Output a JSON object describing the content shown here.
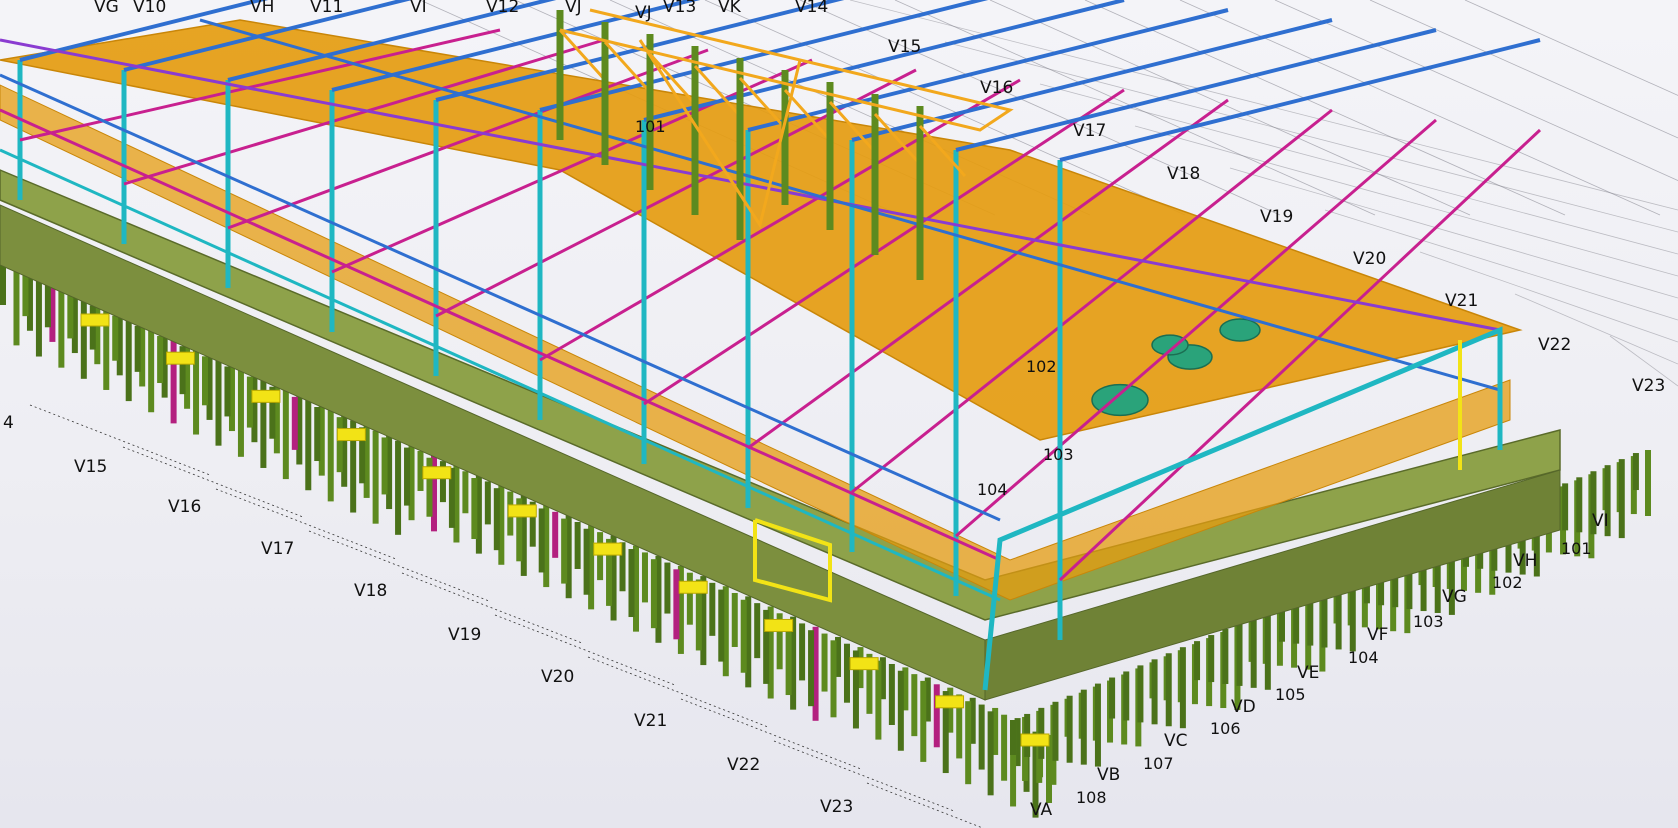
{
  "viewport": {
    "colors": {
      "slab": "#e59c10",
      "slab_dark": "#c98608",
      "floor": "#8ea24a",
      "pile": "#5d8a1f",
      "pile_dark": "#4b721a",
      "pile_magenta": "#b3207f",
      "column_cyan": "#1fb7c2",
      "beam_blue": "#2f6fd0",
      "beam_magenta": "#c8208f",
      "beam_purple": "#8a3bd1",
      "truss_orange": "#f2a81d",
      "pad_yellow": "#f2e316",
      "gridline": "#7c7c86"
    },
    "grid_labels": [
      {
        "text": "VG",
        "name": "grid-label-vg-top"
      },
      {
        "text": "V10",
        "name": "grid-label-v10"
      },
      {
        "text": "VH",
        "name": "grid-label-vh-top"
      },
      {
        "text": "V11",
        "name": "grid-label-v11"
      },
      {
        "text": "VI",
        "name": "grid-label-vi-top"
      },
      {
        "text": "V12",
        "name": "grid-label-v12"
      },
      {
        "text": "VJ",
        "name": "grid-label-vj-a"
      },
      {
        "text": "VJ",
        "name": "grid-label-vj-b"
      },
      {
        "text": "V13",
        "name": "grid-label-v13"
      },
      {
        "text": "VK",
        "name": "grid-label-vk"
      },
      {
        "text": "V14",
        "name": "grid-label-v14-top"
      },
      {
        "text": "V15",
        "name": "grid-label-v15-top"
      },
      {
        "text": "V16",
        "name": "grid-label-v16-top"
      },
      {
        "text": "V17",
        "name": "grid-label-v17-top"
      },
      {
        "text": "V18",
        "name": "grid-label-v18-top"
      },
      {
        "text": "V19",
        "name": "grid-label-v19-top"
      },
      {
        "text": "V20",
        "name": "grid-label-v20-top"
      },
      {
        "text": "V21",
        "name": "grid-label-v21-top"
      },
      {
        "text": "V22",
        "name": "grid-label-v22-top"
      },
      {
        "text": "V23",
        "name": "grid-label-v23-top"
      },
      {
        "text": "4",
        "name": "grid-label-v14-left"
      },
      {
        "text": "V15",
        "name": "grid-label-v15-bottom"
      },
      {
        "text": "V16",
        "name": "grid-label-v16-bottom"
      },
      {
        "text": "V17",
        "name": "grid-label-v17-bottom"
      },
      {
        "text": "V18",
        "name": "grid-label-v18-bottom"
      },
      {
        "text": "V19",
        "name": "grid-label-v19-bottom"
      },
      {
        "text": "V20",
        "name": "grid-label-v20-bottom"
      },
      {
        "text": "V21",
        "name": "grid-label-v21-bottom"
      },
      {
        "text": "V22",
        "name": "grid-label-v22-bottom"
      },
      {
        "text": "V23",
        "name": "grid-label-v23-bottom"
      },
      {
        "text": "VA",
        "name": "grid-label-va"
      },
      {
        "text": "VB",
        "name": "grid-label-vb"
      },
      {
        "text": "VC",
        "name": "grid-label-vc"
      },
      {
        "text": "VD",
        "name": "grid-label-vd"
      },
      {
        "text": "VE",
        "name": "grid-label-ve"
      },
      {
        "text": "VF",
        "name": "grid-label-vf"
      },
      {
        "text": "VG",
        "name": "grid-label-vg-right"
      },
      {
        "text": "VH",
        "name": "grid-label-vh-right"
      },
      {
        "text": "VI",
        "name": "grid-label-vi-right"
      }
    ],
    "level_labels": [
      {
        "text": "101",
        "name": "level-label-101-top"
      },
      {
        "text": "102",
        "name": "level-label-102-mid"
      },
      {
        "text": "103",
        "name": "level-label-103-mid"
      },
      {
        "text": "104",
        "name": "level-label-104-mid"
      },
      {
        "text": "101",
        "name": "level-label-101-right"
      },
      {
        "text": "102",
        "name": "level-label-102-right"
      },
      {
        "text": "103",
        "name": "level-label-103-right"
      },
      {
        "text": "104",
        "name": "level-label-104-right"
      },
      {
        "text": "105",
        "name": "level-label-105"
      },
      {
        "text": "106",
        "name": "level-label-106"
      },
      {
        "text": "107",
        "name": "level-label-107"
      },
      {
        "text": "108",
        "name": "level-label-108"
      }
    ]
  }
}
